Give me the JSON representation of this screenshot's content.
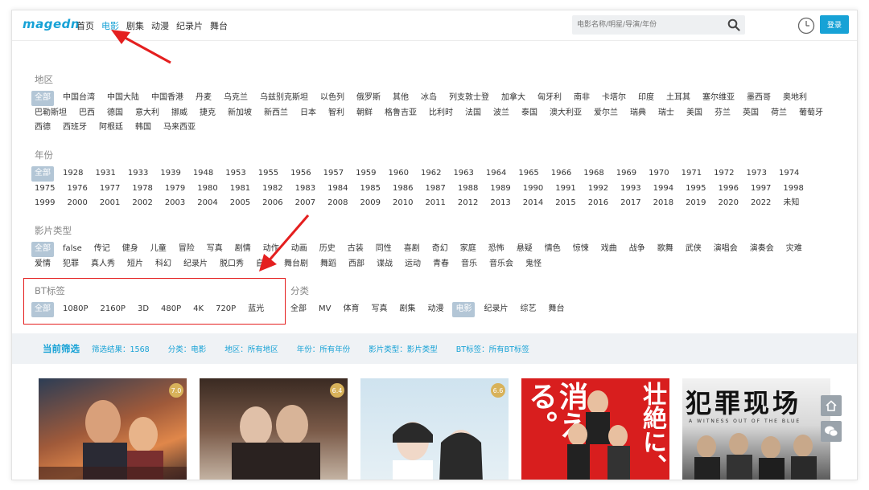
{
  "header": {
    "logo": "magedn",
    "nav": [
      "首页",
      "电影",
      "剧集",
      "动漫",
      "纪录片",
      "舞台"
    ],
    "nav_active": "电影",
    "search_placeholder": "电影名称/明星/导演/年份",
    "login_label": "登录"
  },
  "filters": {
    "region": {
      "label": "地区",
      "options": [
        "全部",
        "中国台湾",
        "中国大陆",
        "中国香港",
        "丹麦",
        "乌克兰",
        "乌兹别克斯坦",
        "以色列",
        "俄罗斯",
        "其他",
        "冰岛",
        "列支敦士登",
        "加拿大",
        "匈牙利",
        "南非",
        "卡塔尔",
        "印度",
        "土耳其",
        "塞尔维亚",
        "墨西哥",
        "奥地利",
        "巴勒斯坦",
        "巴西",
        "德国",
        "意大利",
        "挪威",
        "捷克",
        "新加坡",
        "新西兰",
        "日本",
        "智利",
        "朝鲜",
        "格鲁吉亚",
        "比利时",
        "法国",
        "波兰",
        "泰国",
        "澳大利亚",
        "爱尔兰",
        "瑞典",
        "瑞士",
        "美国",
        "芬兰",
        "英国",
        "荷兰",
        "葡萄牙",
        "西德",
        "西班牙",
        "阿根廷",
        "韩国",
        "马来西亚"
      ]
    },
    "year": {
      "label": "年份",
      "options": [
        "全部",
        "1928",
        "1931",
        "1933",
        "1939",
        "1948",
        "1953",
        "1955",
        "1956",
        "1957",
        "1959",
        "1960",
        "1962",
        "1963",
        "1964",
        "1965",
        "1966",
        "1968",
        "1969",
        "1970",
        "1971",
        "1972",
        "1973",
        "1974",
        "1975",
        "1976",
        "1977",
        "1978",
        "1979",
        "1980",
        "1981",
        "1982",
        "1983",
        "1984",
        "1985",
        "1986",
        "1987",
        "1988",
        "1989",
        "1990",
        "1991",
        "1992",
        "1993",
        "1994",
        "1995",
        "1996",
        "1997",
        "1998",
        "1999",
        "2000",
        "2001",
        "2002",
        "2003",
        "2004",
        "2005",
        "2006",
        "2007",
        "2008",
        "2009",
        "2010",
        "2011",
        "2012",
        "2013",
        "2014",
        "2015",
        "2016",
        "2017",
        "2018",
        "2019",
        "2020",
        "2022",
        "未知"
      ]
    },
    "genre": {
      "label": "影片类型",
      "options": [
        "全部",
        "false",
        "传记",
        "健身",
        "儿童",
        "冒险",
        "写真",
        "剧情",
        "动作",
        "动画",
        "历史",
        "古装",
        "同性",
        "喜剧",
        "奇幻",
        "家庭",
        "恐怖",
        "悬疑",
        "情色",
        "惊悚",
        "戏曲",
        "战争",
        "歌舞",
        "武侠",
        "演唱会",
        "演奏会",
        "灾难",
        "爱情",
        "犯罪",
        "真人秀",
        "短片",
        "科幻",
        "纪录片",
        "脱口秀",
        "自然",
        "舞台剧",
        "舞蹈",
        "西部",
        "谍战",
        "运动",
        "青春",
        "音乐",
        "音乐会",
        "鬼怪"
      ]
    },
    "bt": {
      "label": "BT标签",
      "options": [
        "全部",
        "1080P",
        "2160P",
        "3D",
        "480P",
        "4K",
        "720P",
        "蓝光"
      ]
    },
    "category": {
      "label": "分类",
      "options": [
        "全部",
        "MV",
        "体育",
        "写真",
        "剧集",
        "动漫",
        "电影",
        "纪录片",
        "综艺",
        "舞台"
      ],
      "selected": "电影"
    }
  },
  "summary": {
    "title": "当前筛选",
    "result": "筛选结果：1568",
    "category": "分类：电影",
    "region": "地区：所有地区",
    "year": "年份：所有年份",
    "genre": "影片类型：影片类型",
    "bt": "BT标签：所有BT标签"
  },
  "posters": [
    {
      "rating": "7.0"
    },
    {
      "rating": "6.4"
    },
    {
      "rating": "6.6"
    },
    {
      "rating": "",
      "title": "消える。",
      "title2": "壮絶に、"
    },
    {
      "rating": "",
      "title": "犯罪现场",
      "subtitle": "A WITNESS OUT OF THE BLUE"
    }
  ],
  "colors": {
    "accent": "#17a2d6",
    "selected_chip": "#b3c6d6",
    "highlight_box": "#e41f1f"
  }
}
